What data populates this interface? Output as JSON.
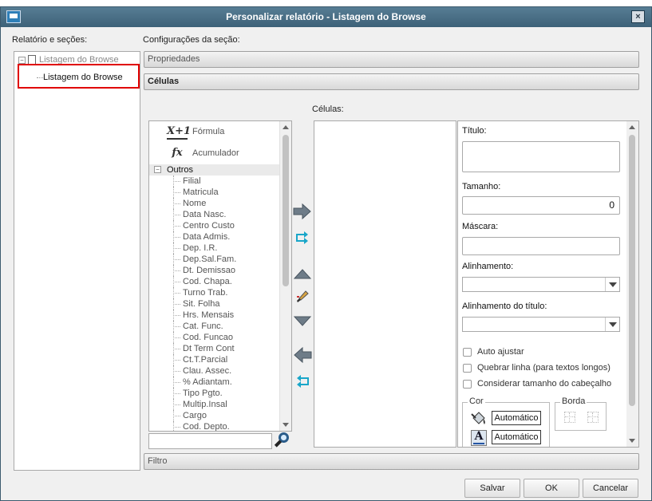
{
  "window": {
    "title": "Personalizar relatório - Listagem do Browse",
    "close_label": "×"
  },
  "left": {
    "label": "Relatório e seções:",
    "tree_root": "Listagem do Browse",
    "tree_child": "Listagem do Browse"
  },
  "config": {
    "label": "Configurações da seção:",
    "sections": [
      "Propriedades",
      "Células",
      "Filtro"
    ]
  },
  "fields": {
    "special": [
      {
        "label": "Fórmula",
        "icon": "formula-icon",
        "glyph": "X+1"
      },
      {
        "label": "Acumulador",
        "icon": "accumulator-icon",
        "glyph": "fx"
      }
    ],
    "group": "Outros",
    "items": [
      "Filial",
      "Matricula",
      "Nome",
      "Data Nasc.",
      "Centro Custo",
      "Data Admis.",
      "Dep. I.R.",
      "Dep.Sal.Fam.",
      "Dt. Demissao",
      "Cod. Chapa.",
      "Turno Trab.",
      "Sit. Folha",
      "Hrs. Mensais",
      "Cat. Func.",
      "Cod. Funcao",
      "Dt Term Cont",
      "Ct.T.Parcial",
      "Clau. Assec.",
      "% Adiantam.",
      "Tipo Pgto.",
      "Multip.Insal",
      "Cargo",
      "Cod. Depto."
    ],
    "search_value": ""
  },
  "cells": {
    "label": "Células:"
  },
  "props": {
    "title_label": "Título:",
    "title_value": "",
    "size_label": "Tamanho:",
    "size_value": "0",
    "mask_label": "Máscara:",
    "mask_value": "",
    "align_label": "Alinhamento:",
    "align_value": "",
    "title_align_label": "Alinhamento do título:",
    "title_align_value": "",
    "checkboxes": [
      "Auto ajustar",
      "Quebrar linha (para textos longos)",
      "Considerar tamanho do cabeçalho"
    ],
    "color_group": "Cor",
    "fill_color_label": "Automático",
    "font_color_label": "Automático",
    "border_group": "Borda"
  },
  "buttons": {
    "save": "Salvar",
    "ok": "OK",
    "cancel": "Cancelar"
  },
  "colors": {
    "titlebar": "#4a6f86",
    "highlight": "#e00000",
    "arrow": "#6e7c88",
    "cyan_arrow": "#19a6c9"
  }
}
